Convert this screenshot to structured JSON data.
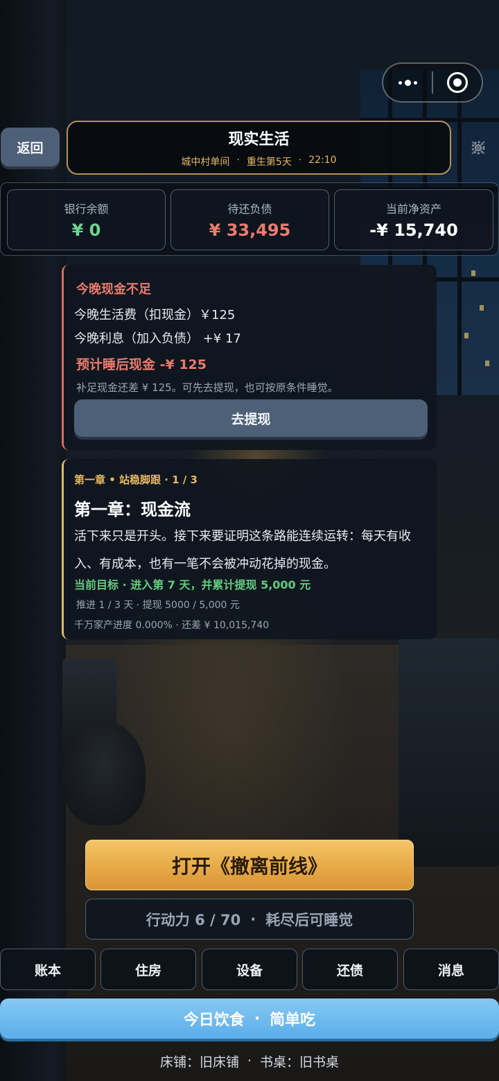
{
  "header": {
    "back_label": "返回",
    "title": "现实生活",
    "location": "城中村单间",
    "day": "重生第5天",
    "time": "22:10",
    "sep": "·"
  },
  "stats": [
    {
      "label": "银行余额",
      "value": "¥ 0",
      "color": "#6fd492"
    },
    {
      "label": "待还负债",
      "value": "¥ 33,495",
      "color": "#ef7b6c"
    },
    {
      "label": "当前净资产",
      "value": "-¥ 15,740",
      "color": "#ffffff"
    }
  ],
  "warning": {
    "heading": "今晚现金不足",
    "line1": "今晚生活费（扣现金）￥125",
    "line2": "今晚利息（加入负债） +¥ 17",
    "line3": "预计睡后现金 -¥ 125",
    "note": "补足现金还差 ¥ 125。可先去提现，也可按原条件睡觉。",
    "button": "去提现"
  },
  "chapter": {
    "tag": "第一章 • 站稳脚跟 · 1 / 3",
    "title": "第一章：现金流",
    "desc": "活下来只是开头。接下来要证明这条路能连续运转：每天有收入、有成本，也有一笔不会被冲动花掉的现金。",
    "goal": "当前目标 · 进入第 7 天，并累计提现 5,000 元",
    "progress": "推进 1 / 3 天 · 提现 5000 / 5,000 元",
    "fortune": "千万家产进度 0.000% · 还差 ¥ 10,015,740"
  },
  "actions": {
    "open_label": "打开《撤离前线》",
    "energy_label": "行动力 6 / 70",
    "energy_sep": "·",
    "energy_hint": "耗尽后可睡觉"
  },
  "nav": [
    "账本",
    "住房",
    "设备",
    "还债",
    "消息"
  ],
  "diet": {
    "label": "今日饮食",
    "sep": "·",
    "value": "简单吃"
  },
  "footer": {
    "bed": "床铺：旧床铺",
    "sep": "·",
    "desk": "书桌：旧书桌"
  },
  "icons": {
    "menu": "more-dots-icon",
    "close": "mini-program-close-icon",
    "settings": "gear-icon"
  }
}
